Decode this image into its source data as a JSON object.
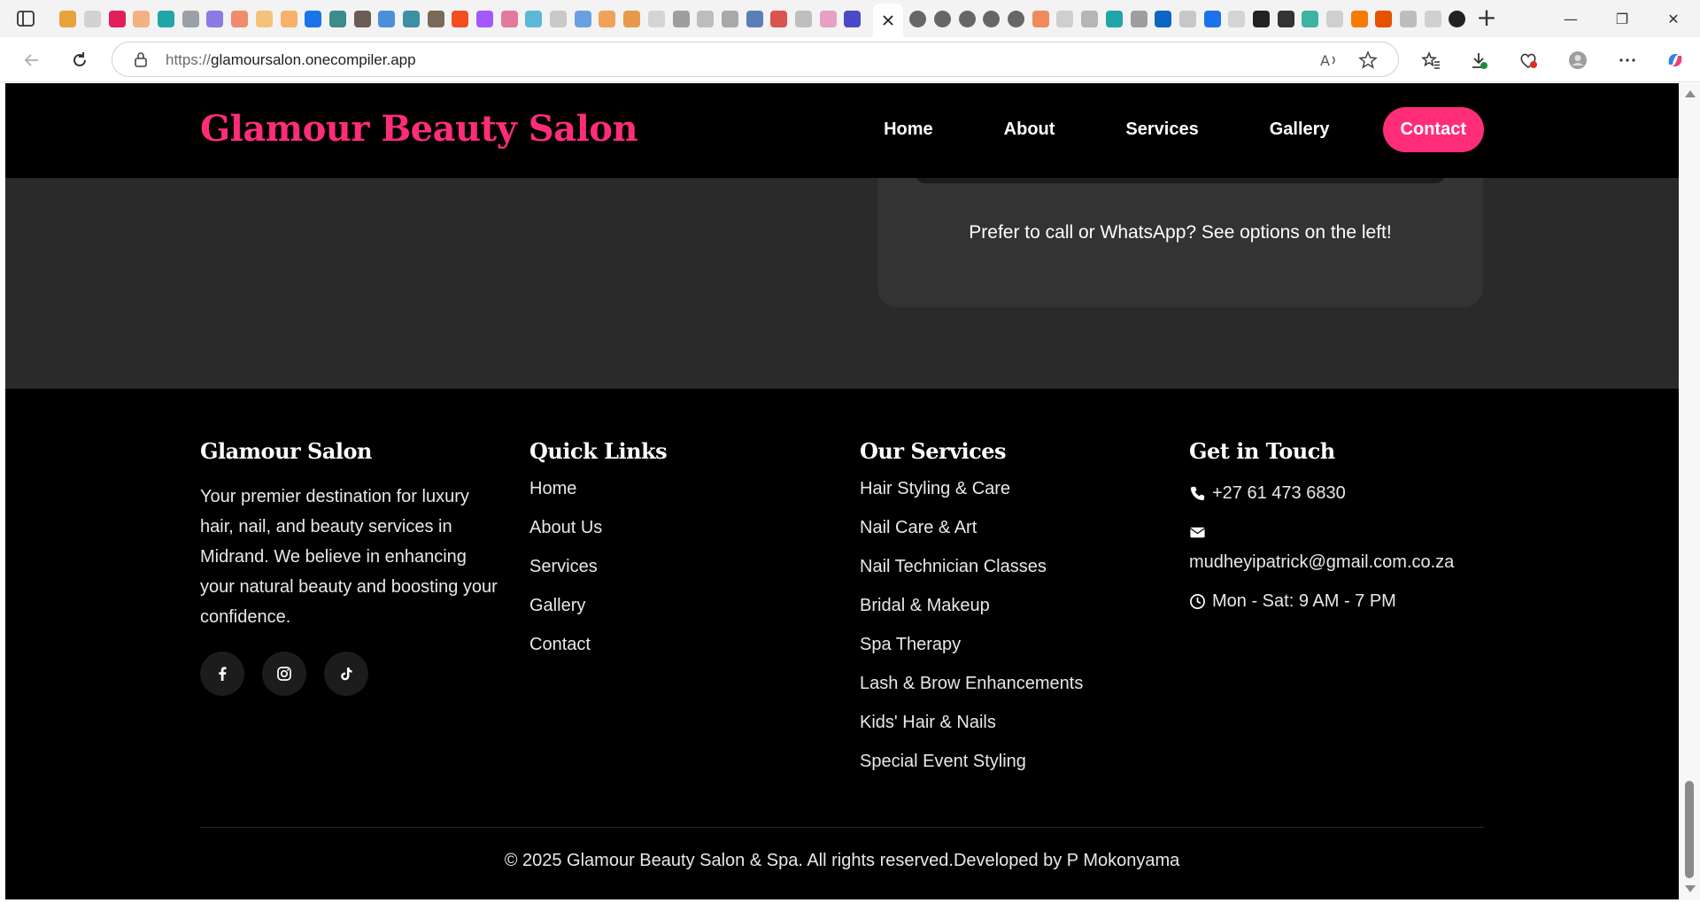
{
  "browser": {
    "url_scheme": "https://",
    "url_host": "glamoursalon.onecompiler.app"
  },
  "header": {
    "brand": "Glamour Beauty Salon",
    "nav": [
      "Home",
      "About",
      "Services",
      "Gallery"
    ],
    "cta": "Contact",
    "accent_color": "#ff2d78"
  },
  "contact": {
    "note": "Prefer to call or WhatsApp? See options on the left!"
  },
  "footer": {
    "about": {
      "title": "Glamour Salon",
      "text": "Your premier destination for luxury hair, nail, and beauty services in Midrand. We believe in enhancing your natural beauty and boosting your confidence.",
      "socials": [
        "facebook-icon",
        "instagram-icon",
        "tiktok-icon"
      ]
    },
    "quick_links": {
      "title": "Quick Links",
      "items": [
        "Home",
        "About Us",
        "Services",
        "Gallery",
        "Contact"
      ]
    },
    "services": {
      "title": "Our Services",
      "items": [
        "Hair Styling & Care",
        "Nail Care & Art",
        "Nail Technician Classes",
        "Bridal & Makeup",
        "Spa Therapy",
        "Lash & Brow Enhancements",
        "Kids' Hair & Nails",
        "Special Event Styling"
      ]
    },
    "touch": {
      "title": "Get in Touch",
      "phone": "+27 61 473 6830",
      "email": "mudheyipatrick@gmail.com.co.za",
      "hours": "Mon - Sat: 9 AM - 7 PM"
    },
    "copyright": "© 2025 Glamour Beauty Salon & Spa. All rights reserved.Developed by P Mokonyama"
  }
}
